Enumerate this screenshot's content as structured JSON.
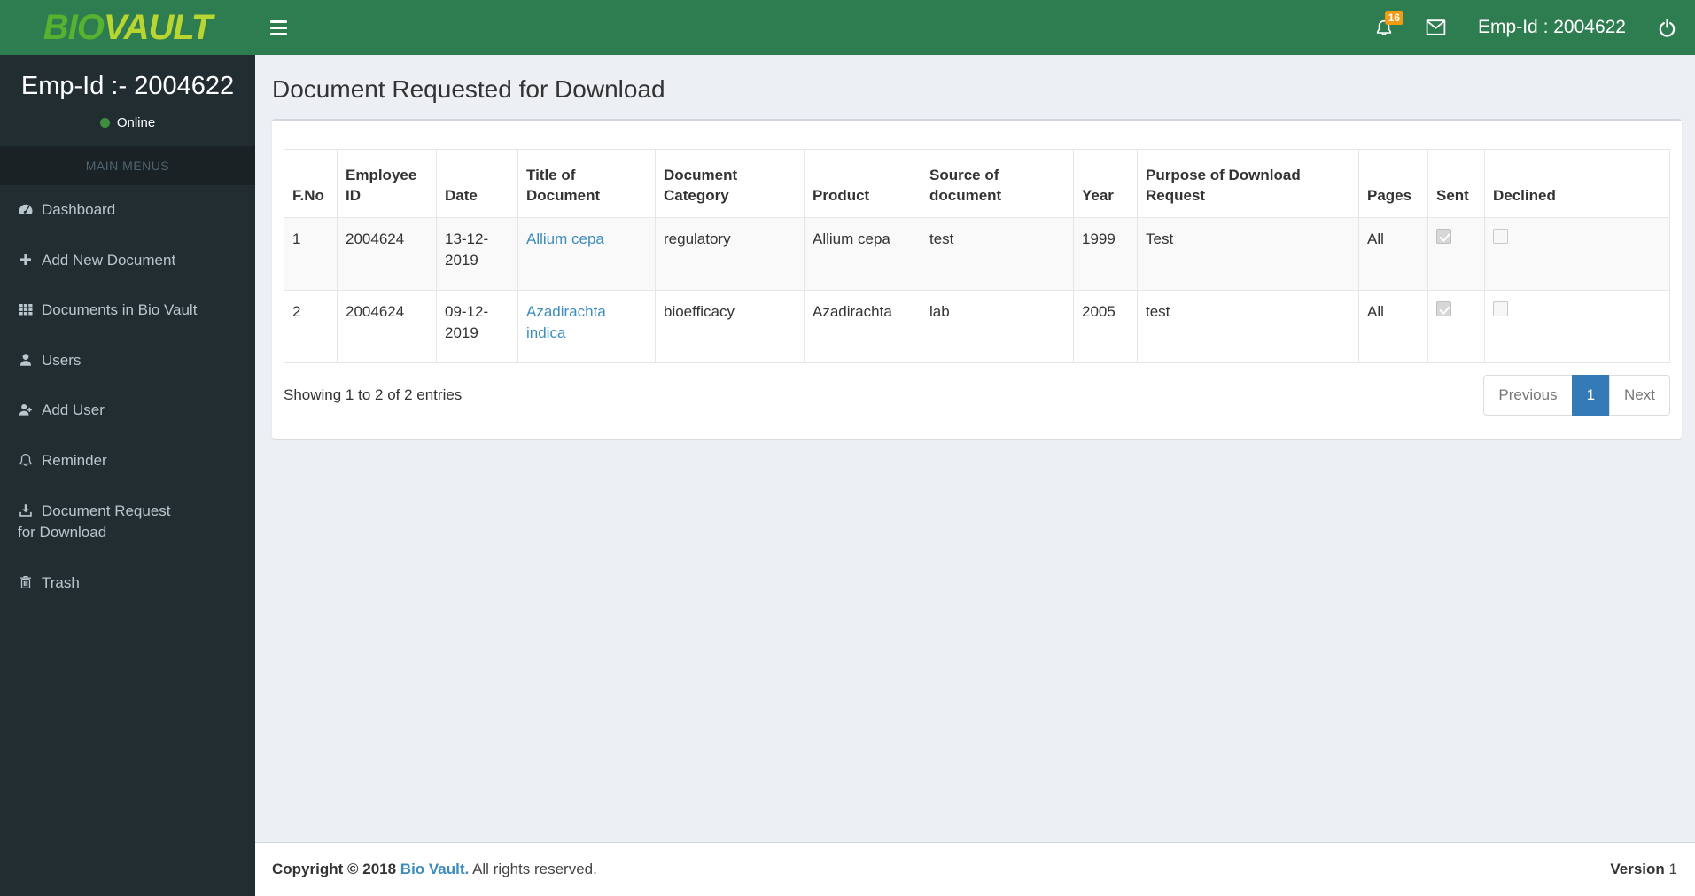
{
  "header": {
    "logo_bio": "BIO",
    "logo_vault": "VAULT",
    "notification_count": "16",
    "emp_id": "Emp-Id : 2004622",
    "icons": [
      "hamburger-icon",
      "bell-icon",
      "envelope-icon",
      "power-icon"
    ]
  },
  "sidebar": {
    "emp_id": "Emp-Id :- 2004622",
    "status": "Online",
    "section_header": "MAIN MENUS",
    "items": [
      {
        "label": "Dashboard",
        "icon": "dashboard-icon"
      },
      {
        "label": "Add New Document",
        "icon": "plus-icon"
      },
      {
        "label": "Documents in Bio Vault",
        "icon": "grid-icon"
      },
      {
        "label": "Users",
        "icon": "user-icon"
      },
      {
        "label": "Add User",
        "icon": "user-plus-icon"
      },
      {
        "label": "Reminder",
        "icon": "bell-icon"
      },
      {
        "label": "Document Request for Download",
        "icon": "download-icon"
      },
      {
        "label": "Trash",
        "icon": "trash-icon"
      }
    ]
  },
  "main": {
    "page_title": "Document Requested for Download",
    "table": {
      "columns": [
        "F.No",
        "Employee ID",
        "Date",
        "Title of Document",
        "Document Category",
        "Product",
        "Source of document",
        "Year",
        "Purpose of Download Request",
        "Pages",
        "Sent",
        "Declined"
      ],
      "rows": [
        {
          "f_no": "1",
          "employee_id": "2004624",
          "date": "13-12-2019",
          "title": "Allium cepa",
          "category": "regulatory",
          "product": "Allium cepa",
          "source": "test",
          "year": "1999",
          "purpose": "Test",
          "pages": "All",
          "sent": true,
          "declined": false
        },
        {
          "f_no": "2",
          "employee_id": "2004624",
          "date": "09-12-2019",
          "title": "Azadirachta indica",
          "category": "bioefficacy",
          "product": "Azadirachta",
          "source": "lab",
          "year": "2005",
          "purpose": "test",
          "pages": "All",
          "sent": true,
          "declined": false
        }
      ]
    },
    "summary": "Showing 1 to 2 of 2 entries",
    "pagination": {
      "previous": "Previous",
      "current": "1",
      "next": "Next"
    }
  },
  "footer": {
    "copyright_prefix": "Copyright © 2018",
    "brand_link": "Bio Vault.",
    "rights": "All rights reserved.",
    "version_label": "Version",
    "version_value": "1"
  },
  "colors": {
    "header_green": "#2e7d51",
    "logo_bio_green": "#56b22f",
    "logo_vault_lime": "#b8d531",
    "sidebar_dark": "#222d32",
    "sidebar_section_dark": "#1a2226",
    "badge_orange": "#f39c12",
    "link_blue": "#3c8dbc",
    "pagination_active_blue": "#337ab7",
    "online_dot_green": "#3e8e41",
    "content_bg": "#ecf0f5"
  }
}
